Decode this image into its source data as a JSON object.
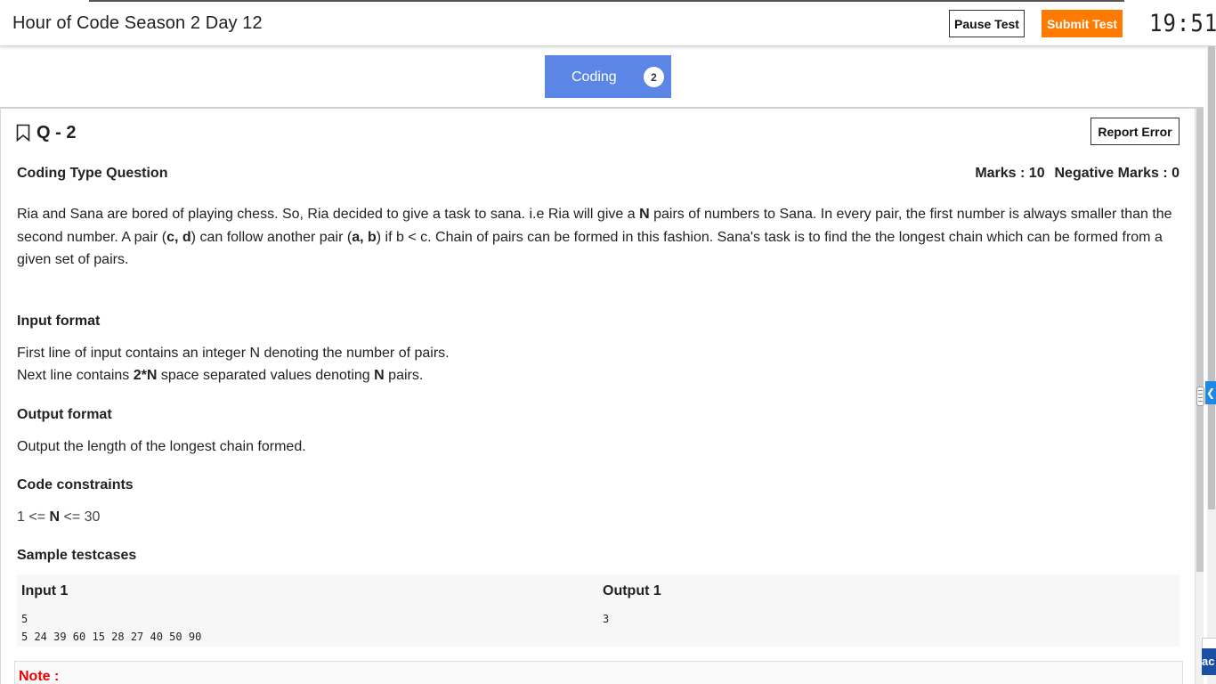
{
  "header": {
    "title": "Hour of Code Season 2 Day 12",
    "pause_label": "Pause Test",
    "submit_label": "Submit Test",
    "timer": "19:51"
  },
  "section_tab": {
    "label": "Coding",
    "count": "2"
  },
  "question": {
    "number": "Q - 2",
    "report_label": "Report Error",
    "type": "Coding Type Question",
    "marks": "Marks : 10",
    "negative_marks": "Negative Marks : 0",
    "statement": {
      "p1": "Ria and Sana are bored of playing chess. So, Ria decided to give a task to sana. i.e Ria will give a ",
      "b1": "N",
      "p2": " pairs of numbers to Sana. In every pair, the first number is always smaller than the second number. A pair (",
      "b2": "c, d",
      "p3": ") can follow another pair (",
      "b3": "a, b",
      "p4": ") if b < c. Chain of pairs can be formed in this fashion. Sana's task is to find the the longest chain which can be formed from a given set of pairs."
    },
    "input_format": {
      "heading": "Input format",
      "line1": "First line of input contains an integer N denoting the number of pairs.",
      "line2_pre": "Next line contains ",
      "line2_b1": "2*N",
      "line2_mid": " space separated values denoting ",
      "line2_b2": "N",
      "line2_post": " pairs."
    },
    "output_format": {
      "heading": "Output format",
      "text": "Output the length of the longest chain formed."
    },
    "constraints": {
      "heading": "Code constraints",
      "pre": "1 <= ",
      "bold": "N",
      "post": " <= 30"
    },
    "samples": {
      "heading": "Sample testcases",
      "input_title": "Input 1",
      "input_body": "5\n5 24 39 60 15 28 27 40 50 90",
      "output_title": "Output 1",
      "output_body": "3"
    },
    "note_label": "Note :"
  },
  "side_panel": {
    "partial_label": "ac"
  },
  "colors": {
    "accent_blue": "#5b86e5",
    "submit_orange": "#ff7a00",
    "note_red": "#e00000"
  }
}
